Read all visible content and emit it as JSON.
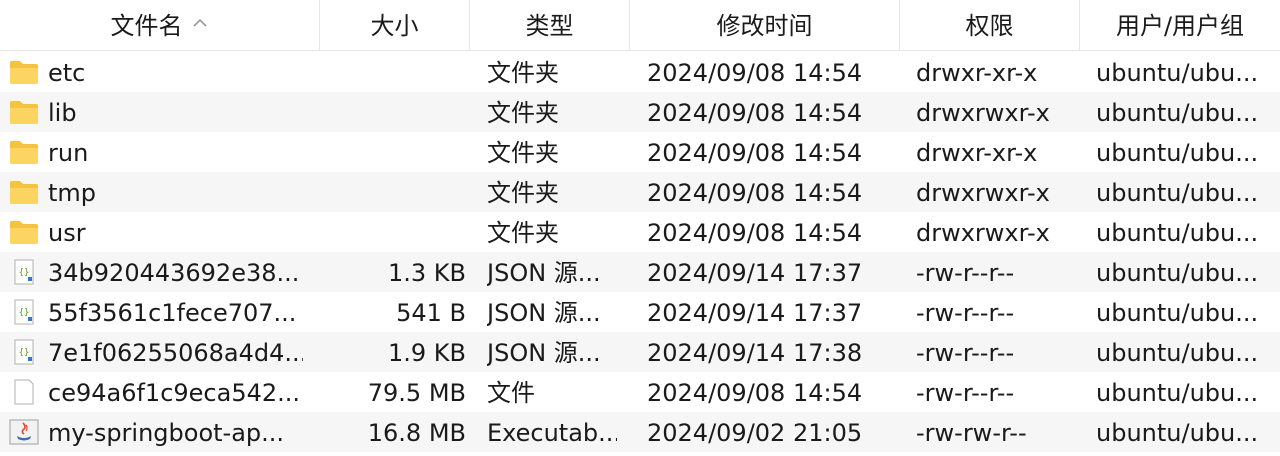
{
  "columns": {
    "name": "文件名",
    "size": "大小",
    "type": "类型",
    "modified": "修改时间",
    "permissions": "权限",
    "owner": "用户/用户组"
  },
  "sort": {
    "column": "name",
    "direction": "ascending",
    "icon": "chevron-up-icon"
  },
  "colors": {
    "row_alt": "#f6f6f6",
    "folder": "#f5c242",
    "grid": "#e6e6e6"
  },
  "files": [
    {
      "name": "etc",
      "size": "",
      "type": "文件夹",
      "modified": "2024/09/08 14:54",
      "permissions": "drwxr-xr-x",
      "owner": "ubuntu/ubu...",
      "icon": "folder-icon"
    },
    {
      "name": "lib",
      "size": "",
      "type": "文件夹",
      "modified": "2024/09/08 14:54",
      "permissions": "drwxrwxr-x",
      "owner": "ubuntu/ubu...",
      "icon": "folder-icon"
    },
    {
      "name": "run",
      "size": "",
      "type": "文件夹",
      "modified": "2024/09/08 14:54",
      "permissions": "drwxr-xr-x",
      "owner": "ubuntu/ubu...",
      "icon": "folder-icon"
    },
    {
      "name": "tmp",
      "size": "",
      "type": "文件夹",
      "modified": "2024/09/08 14:54",
      "permissions": "drwxrwxr-x",
      "owner": "ubuntu/ubu...",
      "icon": "folder-icon"
    },
    {
      "name": "usr",
      "size": "",
      "type": "文件夹",
      "modified": "2024/09/08 14:54",
      "permissions": "drwxrwxr-x",
      "owner": "ubuntu/ubu...",
      "icon": "folder-icon"
    },
    {
      "name": "34b920443692e38...",
      "size": "1.3 KB",
      "type": "JSON 源...",
      "modified": "2024/09/14 17:37",
      "permissions": "-rw-r--r--",
      "owner": "ubuntu/ubu...",
      "icon": "json-file-icon"
    },
    {
      "name": "55f3561c1fece707...",
      "size": "541 B",
      "type": "JSON 源...",
      "modified": "2024/09/14 17:37",
      "permissions": "-rw-r--r--",
      "owner": "ubuntu/ubu...",
      "icon": "json-file-icon"
    },
    {
      "name": "7e1f06255068a4d4...",
      "size": "1.9 KB",
      "type": "JSON 源...",
      "modified": "2024/09/14 17:38",
      "permissions": "-rw-r--r--",
      "owner": "ubuntu/ubu...",
      "icon": "json-file-icon"
    },
    {
      "name": "ce94a6f1c9eca542...",
      "size": "79.5 MB",
      "type": "文件",
      "modified": "2024/09/08 14:54",
      "permissions": "-rw-r--r--",
      "owner": "ubuntu/ubu...",
      "icon": "blank-file-icon"
    },
    {
      "name": "my-springboot-ap...",
      "size": "16.8 MB",
      "type": "Executab...",
      "modified": "2024/09/02 21:05",
      "permissions": "-rw-rw-r--",
      "owner": "ubuntu/ubu...",
      "icon": "java-jar-icon"
    }
  ]
}
